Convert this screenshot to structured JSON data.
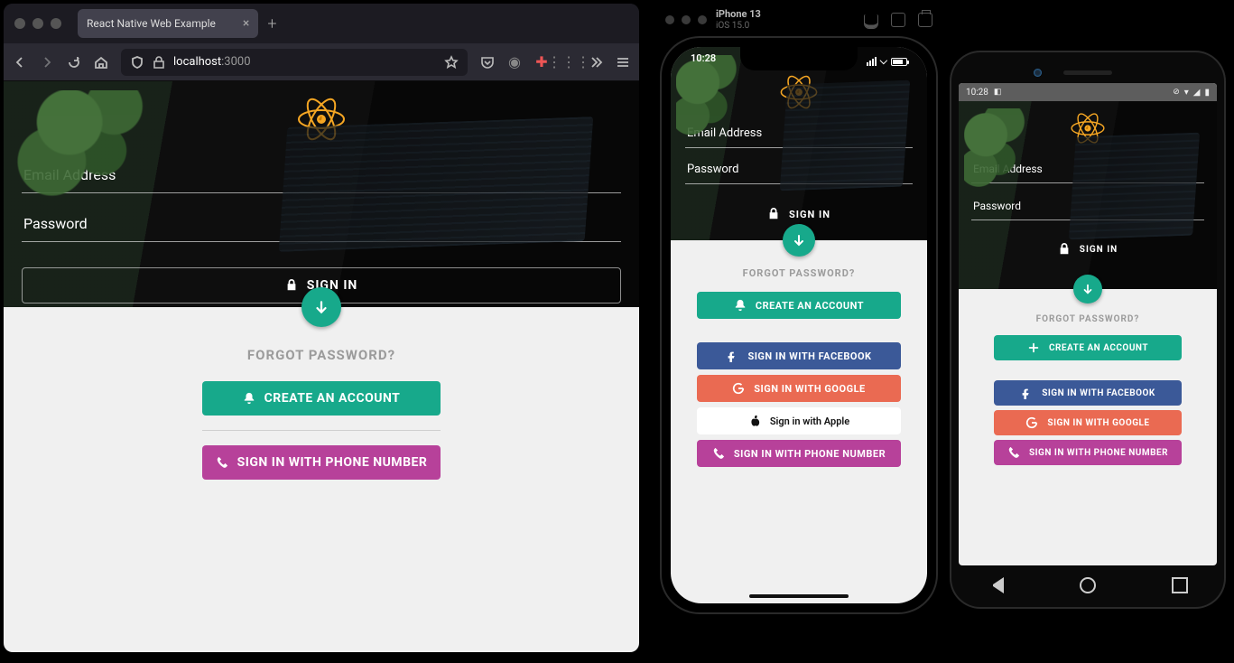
{
  "browser": {
    "tab_title": "React Native Web Example",
    "url_host": "localhost",
    "url_port": ":3000"
  },
  "simulator": {
    "device": "iPhone 13",
    "os": "iOS 15.0",
    "clock": "10:28"
  },
  "emulator": {
    "clock": "10:28"
  },
  "app": {
    "email_label": "Email Address",
    "password_label": "Password",
    "signin": "SIGN IN",
    "forgot": "FORGOT PASSWORD?",
    "create": "CREATE AN ACCOUNT",
    "facebook": "SIGN IN WITH FACEBOOK",
    "google": "SIGN IN WITH GOOGLE",
    "apple": "Sign in with Apple",
    "phone": "SIGN IN WITH PHONE NUMBER"
  }
}
